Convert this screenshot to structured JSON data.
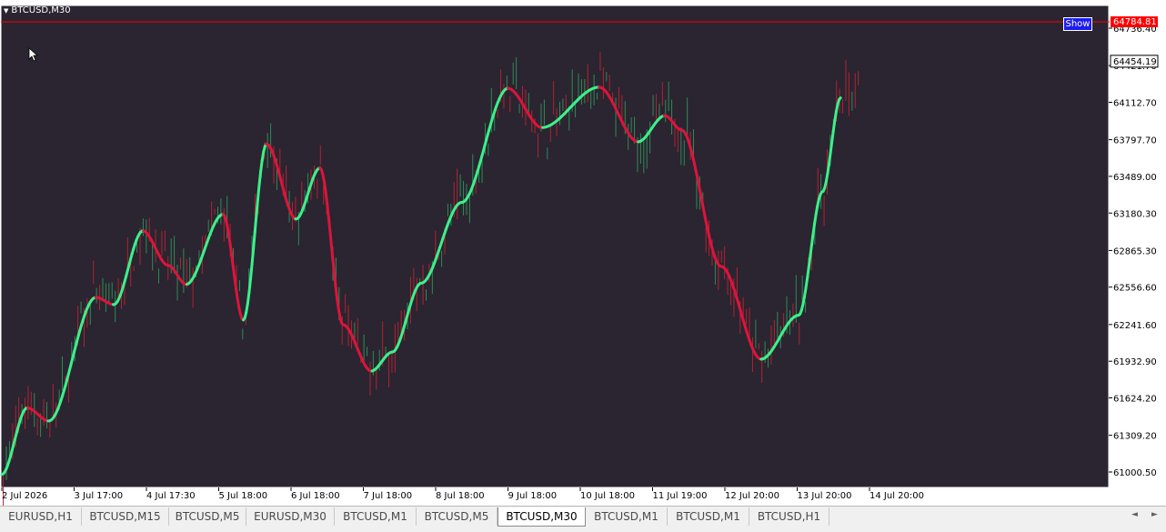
{
  "window": {
    "symbol_title": "BTCUSD,M30",
    "show_button_label": "Show"
  },
  "colors": {
    "background": "#2a2530",
    "bull_candle": "#2e8b57",
    "bear_candle": "#b22234",
    "ma_up": "#3cf08a",
    "ma_down": "#dc143c",
    "axis_text": "#000000",
    "price_line": "#ff0000"
  },
  "icons": {
    "collapse": "triangle-down-icon",
    "cursor": "mouse-pointer-icon",
    "scroll_left": "arrow-left-icon",
    "scroll_right": "arrow-right-icon"
  },
  "chart_data": {
    "type": "candlestick",
    "symbol": "BTCUSD",
    "timeframe": "M30",
    "price_ticks": [
      64736.4,
      64421.7,
      64112.7,
      63797.7,
      63489.0,
      63180.3,
      62865.3,
      62556.6,
      62241.6,
      61932.9,
      61624.2,
      61309.2,
      61000.5
    ],
    "price_tick_labels": [
      "64736.40",
      "64421.70",
      "64112.70",
      "63797.70",
      "63489.00",
      "63180.30",
      "62865.30",
      "62556.60",
      "62241.60",
      "61932.90",
      "61624.20",
      "61309.20",
      "61000.50"
    ],
    "ylim": [
      60900,
      64840
    ],
    "time_labels": [
      "2 Jul 2026",
      "3 Jul 17:00",
      "4 Jul 17:30",
      "5 Jul 18:00",
      "6 Jul 18:00",
      "7 Jul 18:00",
      "8 Jul 18:00",
      "9 Jul 18:00",
      "10 Jul 18:00",
      "11 Jul 19:00",
      "12 Jul 20:00",
      "13 Jul 20:00",
      "14 Jul 20:00"
    ],
    "current_price": "64454.19",
    "top_price_label": "64784.81",
    "moving_average": {
      "name": "trend line",
      "up_color": "#3cf08a",
      "down_color": "#dc143c",
      "values": [
        {
          "t": 0.0,
          "v": 60980
        },
        {
          "t": 0.35,
          "v": 61540
        },
        {
          "t": 0.65,
          "v": 61430
        },
        {
          "t": 1.3,
          "v": 62470
        },
        {
          "t": 1.55,
          "v": 62410
        },
        {
          "t": 1.95,
          "v": 63030
        },
        {
          "t": 2.3,
          "v": 62740
        },
        {
          "t": 2.55,
          "v": 62580
        },
        {
          "t": 3.06,
          "v": 63170
        },
        {
          "t": 3.34,
          "v": 62280
        },
        {
          "t": 3.66,
          "v": 63760
        },
        {
          "t": 4.07,
          "v": 63130
        },
        {
          "t": 4.4,
          "v": 63560
        },
        {
          "t": 4.72,
          "v": 62240
        },
        {
          "t": 5.11,
          "v": 61850
        },
        {
          "t": 5.4,
          "v": 62010
        },
        {
          "t": 5.8,
          "v": 62590
        },
        {
          "t": 6.36,
          "v": 63270
        },
        {
          "t": 7.0,
          "v": 64230
        },
        {
          "t": 7.47,
          "v": 63900
        },
        {
          "t": 8.26,
          "v": 64240
        },
        {
          "t": 8.8,
          "v": 63780
        },
        {
          "t": 9.17,
          "v": 64000
        },
        {
          "t": 9.4,
          "v": 63880
        },
        {
          "t": 9.95,
          "v": 62730
        },
        {
          "t": 10.5,
          "v": 61950
        },
        {
          "t": 11.02,
          "v": 62320
        },
        {
          "t": 11.35,
          "v": 63360
        },
        {
          "t": 11.6,
          "v": 64150
        }
      ]
    }
  },
  "tabs": [
    {
      "label": "EURUSD,H1",
      "active": false
    },
    {
      "label": "BTCUSD,M15",
      "active": false
    },
    {
      "label": "BTCUSD,M5",
      "active": false
    },
    {
      "label": "EURUSD,M30",
      "active": false
    },
    {
      "label": "BTCUSD,M1",
      "active": false
    },
    {
      "label": "BTCUSD,M5",
      "active": false
    },
    {
      "label": "BTCUSD,M30",
      "active": true
    },
    {
      "label": "BTCUSD,M1",
      "active": false
    },
    {
      "label": "BTCUSD,M1",
      "active": false
    },
    {
      "label": "BTCUSD,H1",
      "active": false
    }
  ]
}
